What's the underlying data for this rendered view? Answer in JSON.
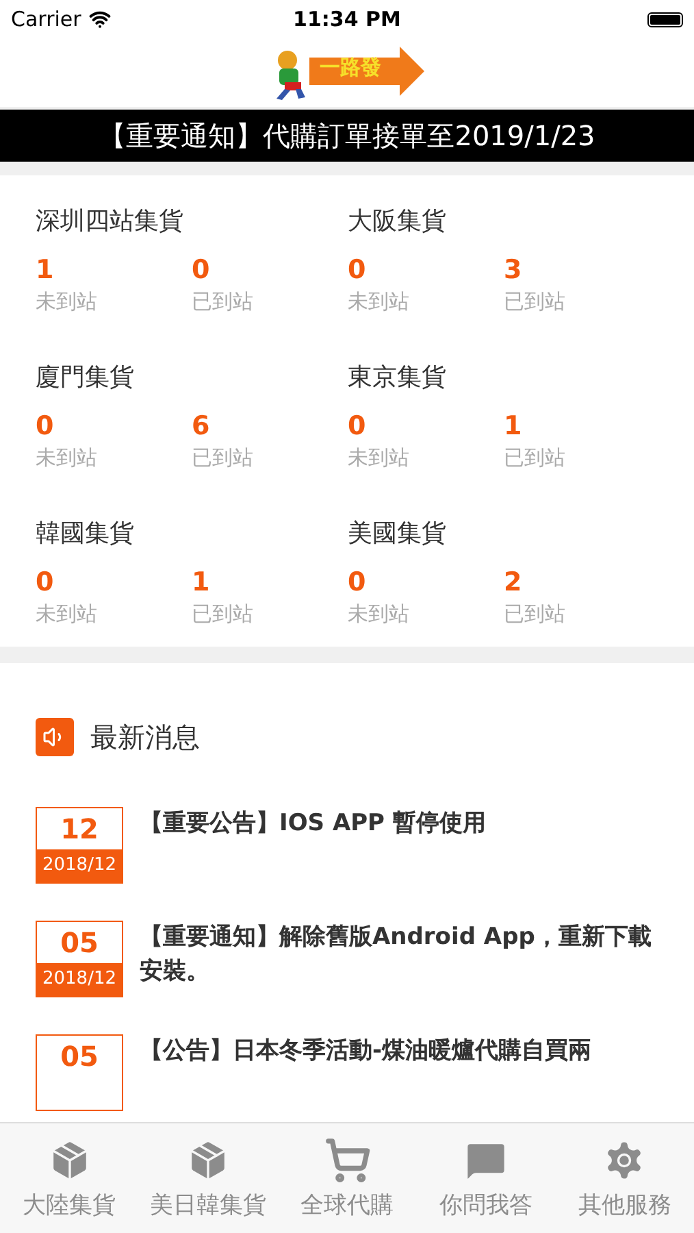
{
  "status_bar": {
    "carrier": "Carrier",
    "time": "11:34 PM"
  },
  "logo": {
    "text": "一路發"
  },
  "banner": "【重要通知】代購訂單接單至2019/1/23",
  "warehouses": [
    {
      "name": "深圳四站集貨",
      "stats": [
        {
          "value": "1",
          "label": "未到站"
        },
        {
          "value": "0",
          "label": "已到站"
        }
      ]
    },
    {
      "name": "大阪集貨",
      "stats": [
        {
          "value": "0",
          "label": "未到站"
        },
        {
          "value": "3",
          "label": "已到站"
        }
      ]
    },
    {
      "name": "廈門集貨",
      "stats": [
        {
          "value": "0",
          "label": "未到站"
        },
        {
          "value": "6",
          "label": "已到站"
        }
      ]
    },
    {
      "name": "東京集貨",
      "stats": [
        {
          "value": "0",
          "label": "未到站"
        },
        {
          "value": "1",
          "label": "已到站"
        }
      ]
    },
    {
      "name": "韓國集貨",
      "stats": [
        {
          "value": "0",
          "label": "未到站"
        },
        {
          "value": "1",
          "label": "已到站"
        }
      ]
    },
    {
      "name": "美國集貨",
      "stats": [
        {
          "value": "0",
          "label": "未到站"
        },
        {
          "value": "2",
          "label": "已到站"
        }
      ]
    }
  ],
  "news": {
    "title": "最新消息",
    "items": [
      {
        "day": "12",
        "month": "2018/12",
        "text": "【重要公告】IOS APP 暫停使用"
      },
      {
        "day": "05",
        "month": "2018/12",
        "text": "【重要通知】解除舊版Android App，重新下載安裝。"
      },
      {
        "day": "05",
        "text": "【公告】日本冬季活動-煤油暖爐代購自買兩"
      }
    ]
  },
  "tab_bar": [
    {
      "label": "大陸集貨",
      "selected": false
    },
    {
      "label": "美日韓集貨",
      "selected": false
    },
    {
      "label": "全球代購",
      "selected": false
    },
    {
      "label": "你問我答",
      "selected": false
    },
    {
      "label": "其他服務",
      "selected": false
    }
  ]
}
